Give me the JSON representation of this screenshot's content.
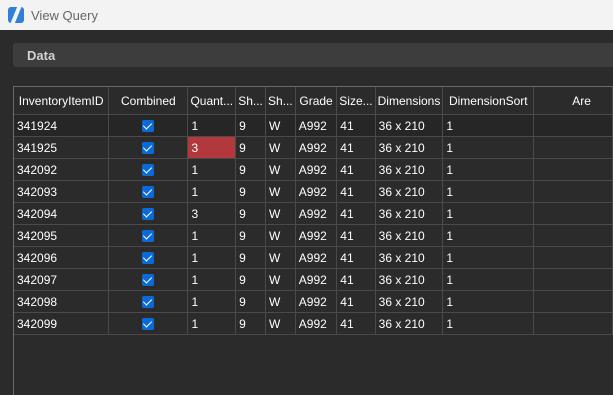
{
  "window": {
    "title": "View Query",
    "icon": "app-slash-icon"
  },
  "panel": {
    "header": "Data"
  },
  "grid": {
    "columns": [
      "InventoryItemID",
      "Combined",
      "Quant...",
      "Sh...",
      "Sh...",
      "Grade",
      "Size...",
      "Dimensions",
      "DimensionSort",
      "Are"
    ],
    "rows": [
      {
        "id": "341924",
        "combined": true,
        "quantity": "1",
        "sh1": "9",
        "sh2": "W",
        "grade": "A992",
        "size": "41",
        "dimensions": "36 x 210",
        "dimsort": "1",
        "area": ""
      },
      {
        "id": "341925",
        "combined": true,
        "quantity": "3",
        "sh1": "9",
        "sh2": "W",
        "grade": "A992",
        "size": "41",
        "dimensions": "36 x 210",
        "dimsort": "1",
        "area": "",
        "highlight": true
      },
      {
        "id": "342092",
        "combined": true,
        "quantity": "1",
        "sh1": "9",
        "sh2": "W",
        "grade": "A992",
        "size": "41",
        "dimensions": "36 x 210",
        "dimsort": "1",
        "area": ""
      },
      {
        "id": "342093",
        "combined": true,
        "quantity": "1",
        "sh1": "9",
        "sh2": "W",
        "grade": "A992",
        "size": "41",
        "dimensions": "36 x 210",
        "dimsort": "1",
        "area": ""
      },
      {
        "id": "342094",
        "combined": true,
        "quantity": "3",
        "sh1": "9",
        "sh2": "W",
        "grade": "A992",
        "size": "41",
        "dimensions": "36 x 210",
        "dimsort": "1",
        "area": ""
      },
      {
        "id": "342095",
        "combined": true,
        "quantity": "1",
        "sh1": "9",
        "sh2": "W",
        "grade": "A992",
        "size": "41",
        "dimensions": "36 x 210",
        "dimsort": "1",
        "area": ""
      },
      {
        "id": "342096",
        "combined": true,
        "quantity": "1",
        "sh1": "9",
        "sh2": "W",
        "grade": "A992",
        "size": "41",
        "dimensions": "36 x 210",
        "dimsort": "1",
        "area": ""
      },
      {
        "id": "342097",
        "combined": true,
        "quantity": "1",
        "sh1": "9",
        "sh2": "W",
        "grade": "A992",
        "size": "41",
        "dimensions": "36 x 210",
        "dimsort": "1",
        "area": ""
      },
      {
        "id": "342098",
        "combined": true,
        "quantity": "1",
        "sh1": "9",
        "sh2": "W",
        "grade": "A992",
        "size": "41",
        "dimensions": "36 x 210",
        "dimsort": "1",
        "area": ""
      },
      {
        "id": "342099",
        "combined": true,
        "quantity": "1",
        "sh1": "9",
        "sh2": "W",
        "grade": "A992",
        "size": "41",
        "dimensions": "36 x 210",
        "dimsort": "1",
        "area": ""
      }
    ]
  },
  "colors": {
    "background": "#2b2b2b",
    "titlebar": "#f3f3f3",
    "checkbox": "#0a6bd8",
    "highlight": "#b3383e"
  }
}
